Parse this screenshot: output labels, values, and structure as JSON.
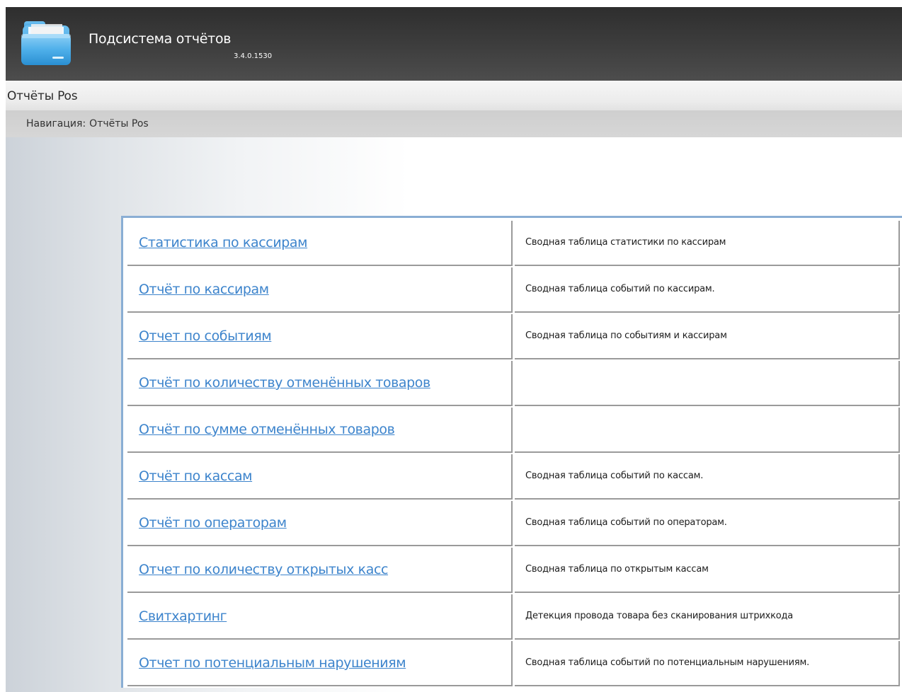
{
  "header": {
    "title": "Подсистема отчётов",
    "version": "3.4.0.1530",
    "logo_icon": "folder-icon"
  },
  "section": {
    "title": "Отчёты Pos"
  },
  "breadcrumb": {
    "label": "Навигация:",
    "current": "Отчёты Pos"
  },
  "reports": [
    {
      "name": "Статистика по кассирам",
      "description": "Сводная таблица статистики по кассирам"
    },
    {
      "name": "Отчёт по кассирам",
      "description": "Сводная таблица событий по кассирам."
    },
    {
      "name": "Отчет по событиям",
      "description": "Сводная таблица по событиям и кассирам"
    },
    {
      "name": "Отчёт по количеству отменённых товаров",
      "description": ""
    },
    {
      "name": "Отчёт по сумме отменённых товаров",
      "description": ""
    },
    {
      "name": "Отчёт по кассам",
      "description": "Сводная таблица событий по кассам."
    },
    {
      "name": "Отчёт по операторам",
      "description": "Сводная таблица событий по операторам."
    },
    {
      "name": "Отчет по количеству открытых касс",
      "description": "Сводная таблица по открытым кассам"
    },
    {
      "name": "Свитхартинг",
      "description": "Детекция провода товара без сканирования штрихкода"
    },
    {
      "name": "Отчет по потенциальным нарушениям",
      "description": "Сводная таблица событий по потенциальным нарушениям."
    }
  ],
  "colors": {
    "link": "#3d84cc",
    "table_border": "#8aaed4",
    "header_dark": "#3e3e3e"
  }
}
